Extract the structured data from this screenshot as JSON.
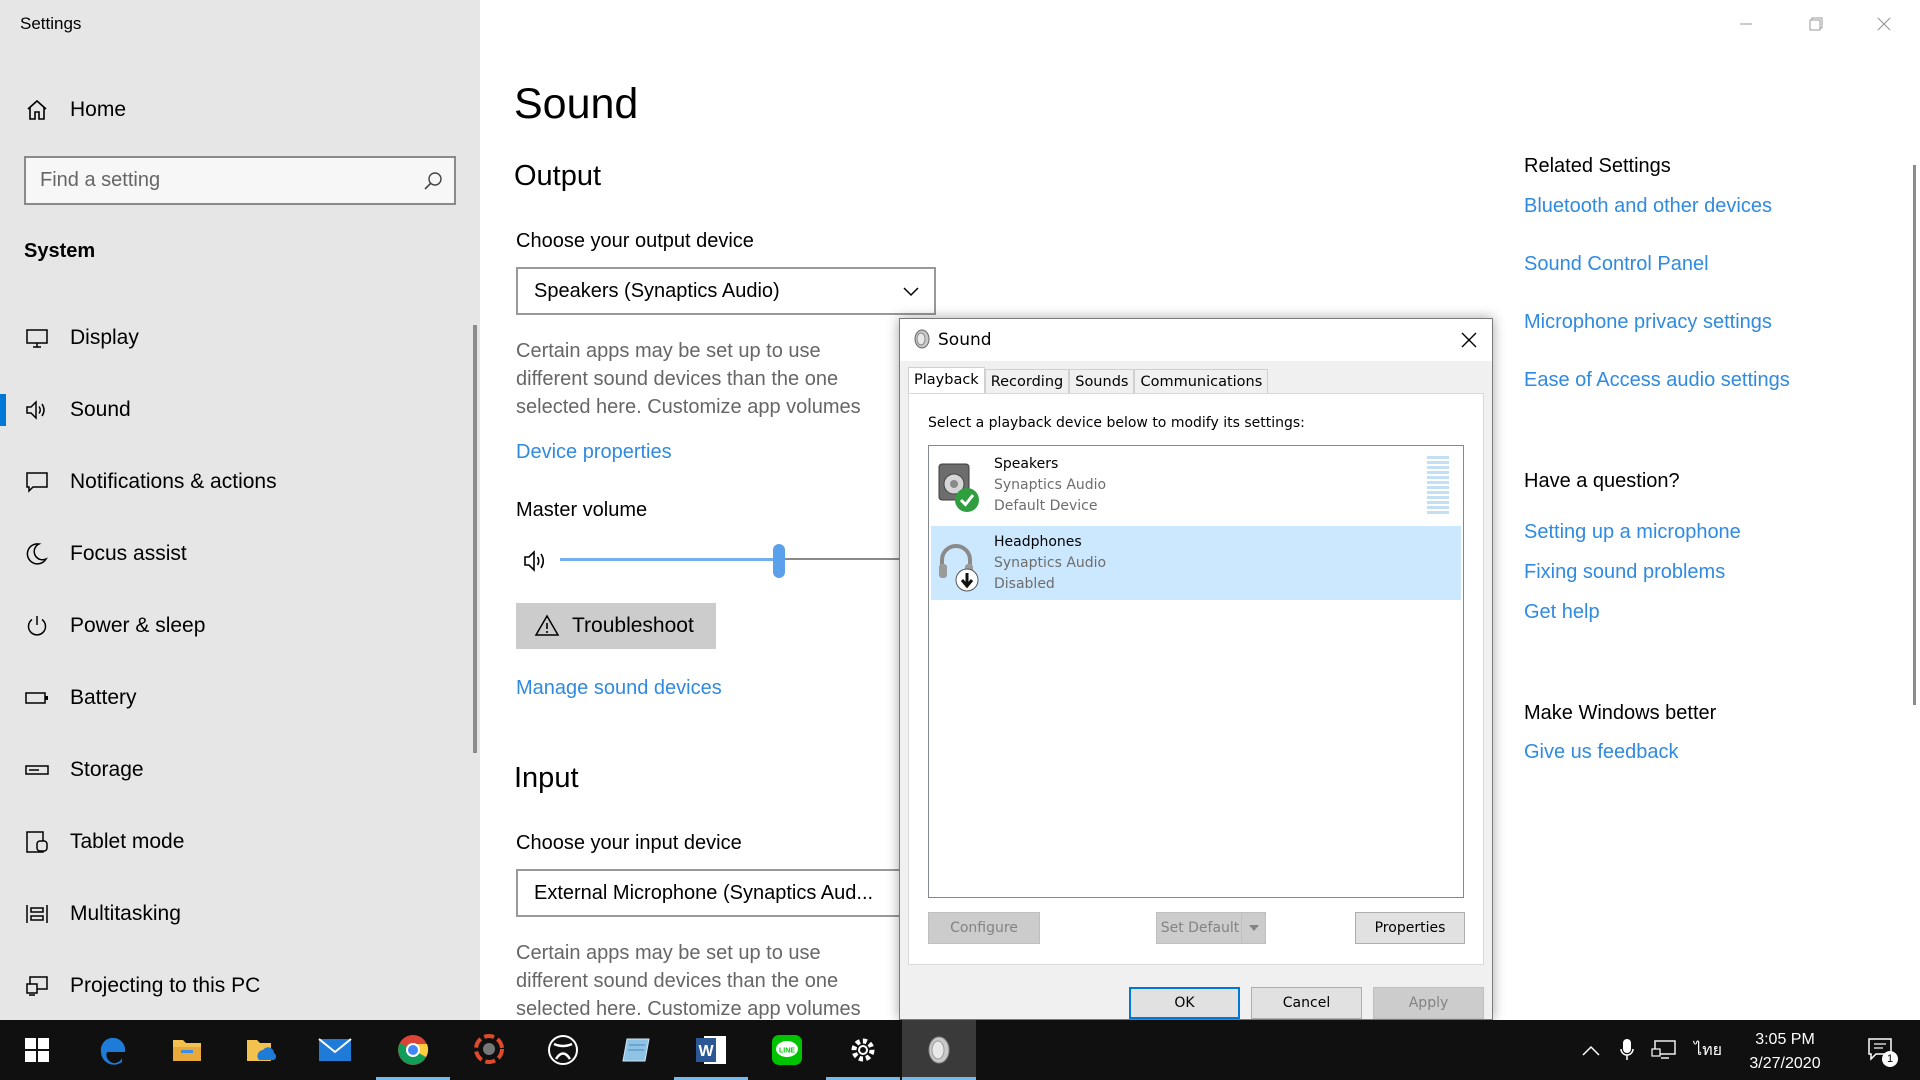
{
  "app_title": "Settings",
  "sidebar": {
    "home_label": "Home",
    "search_placeholder": "Find a setting",
    "section": "System",
    "items": [
      {
        "label": "Display",
        "icon": "monitor-icon"
      },
      {
        "label": "Sound",
        "icon": "speaker-icon",
        "active": true
      },
      {
        "label": "Notifications & actions",
        "icon": "notification-icon"
      },
      {
        "label": "Focus assist",
        "icon": "moon-icon"
      },
      {
        "label": "Power & sleep",
        "icon": "power-icon"
      },
      {
        "label": "Battery",
        "icon": "battery-icon"
      },
      {
        "label": "Storage",
        "icon": "storage-icon"
      },
      {
        "label": "Tablet mode",
        "icon": "tablet-icon"
      },
      {
        "label": "Multitasking",
        "icon": "multitasking-icon"
      },
      {
        "label": "Projecting to this PC",
        "icon": "projecting-icon"
      }
    ]
  },
  "main": {
    "title": "Sound",
    "output": {
      "heading": "Output",
      "choose_label": "Choose your output device",
      "device": "Speakers (Synaptics Audio)",
      "desc": "Certain apps may be set up to use different sound devices than the one selected here. Customize app volumes and devices in advanced sound options.",
      "device_properties_link": "Device properties",
      "master_volume_label": "Master volume",
      "volume_level": 0.56,
      "troubleshoot_label": "Troubleshoot",
      "manage_link": "Manage sound devices"
    },
    "input": {
      "heading": "Input",
      "choose_label": "Choose your input device",
      "device": "External Microphone (Synaptics Aud...",
      "desc": "Certain apps may be set up to use different sound devices than the one selected here. Customize app volumes and devices in advanced sound options."
    }
  },
  "related": {
    "heading": "Related Settings",
    "links": [
      "Bluetooth and other devices",
      "Sound Control Panel",
      "Microphone privacy settings",
      "Ease of Access audio settings"
    ],
    "question_heading": "Have a question?",
    "question_links": [
      "Setting up a microphone",
      "Fixing sound problems",
      "Get help"
    ],
    "better_heading": "Make Windows better",
    "feedback_link": "Give us feedback"
  },
  "dialog": {
    "title": "Sound",
    "tabs": [
      "Playback",
      "Recording",
      "Sounds",
      "Communications"
    ],
    "selected_tab": "Playback",
    "instruction": "Select a playback device below to modify its settings:",
    "devices": [
      {
        "name": "Speakers",
        "driver": "Synaptics Audio",
        "status": "Default Device",
        "selected": false
      },
      {
        "name": "Headphones",
        "driver": "Synaptics Audio",
        "status": "Disabled",
        "selected": true
      }
    ],
    "buttons": {
      "configure": "Configure",
      "set_default": "Set Default",
      "properties": "Properties",
      "ok": "OK",
      "cancel": "Cancel",
      "apply": "Apply"
    }
  },
  "taskbar": {
    "apps": [
      "start-icon",
      "edge-icon",
      "file-explorer-icon",
      "onedrive-folder-icon",
      "mail-icon",
      "chrome-icon",
      "photoscape-icon",
      "xbox-icon",
      "notepad-icon",
      "word-icon",
      "line-icon",
      "settings-icon",
      "sound-dialog-icon"
    ],
    "language": "ไทย",
    "time": "3:05 PM",
    "date": "3/27/2020",
    "notification_count": "1"
  },
  "colors": {
    "accent": "#0078d7",
    "link": "#2f8ae0",
    "sidebar_bg": "#e6e6e6",
    "taskbar_bg": "#101010",
    "selection": "#cce8ff"
  }
}
